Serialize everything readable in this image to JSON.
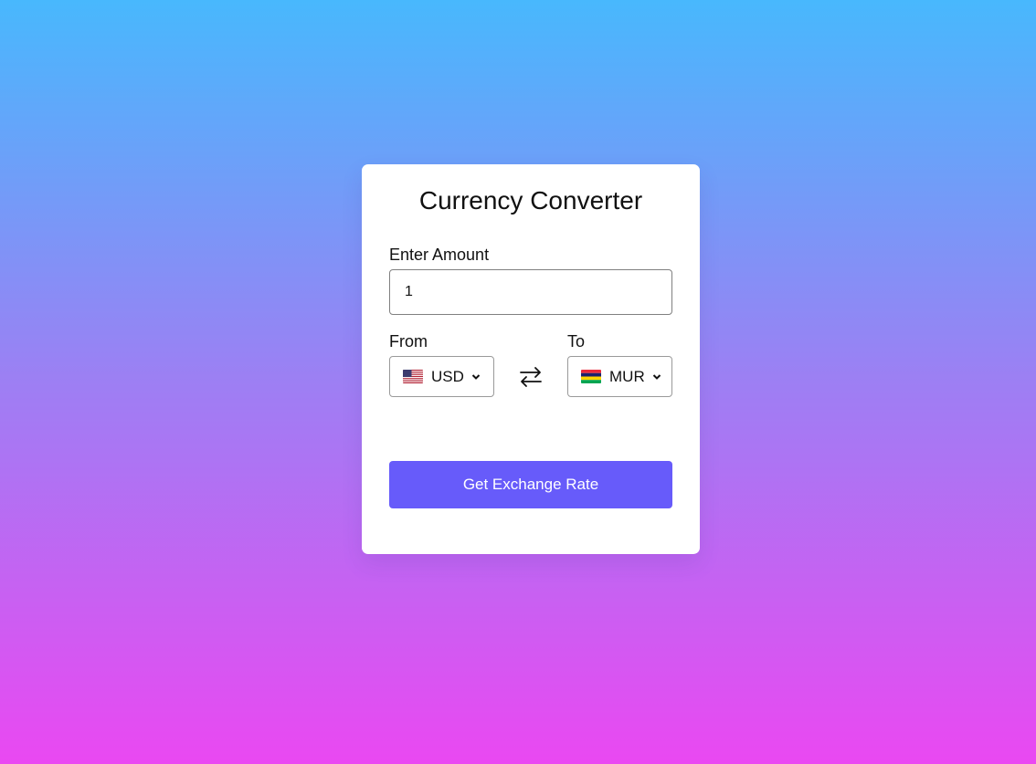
{
  "converter": {
    "title": "Currency Converter",
    "amount_label": "Enter Amount",
    "amount_value": "1",
    "from_label": "From",
    "to_label": "To",
    "from_currency": "USD",
    "from_flag_icon": "us-flag-icon",
    "to_currency": "MUR",
    "to_flag_icon": "mauritius-flag-icon",
    "swap_icon": "exchange-arrows-icon",
    "submit_label": "Get Exchange Rate"
  },
  "colors": {
    "gradient_top": "#48b8fd",
    "gradient_bottom": "#ea48f2",
    "button_bg": "#675bfa",
    "card_bg": "#ffffff"
  }
}
